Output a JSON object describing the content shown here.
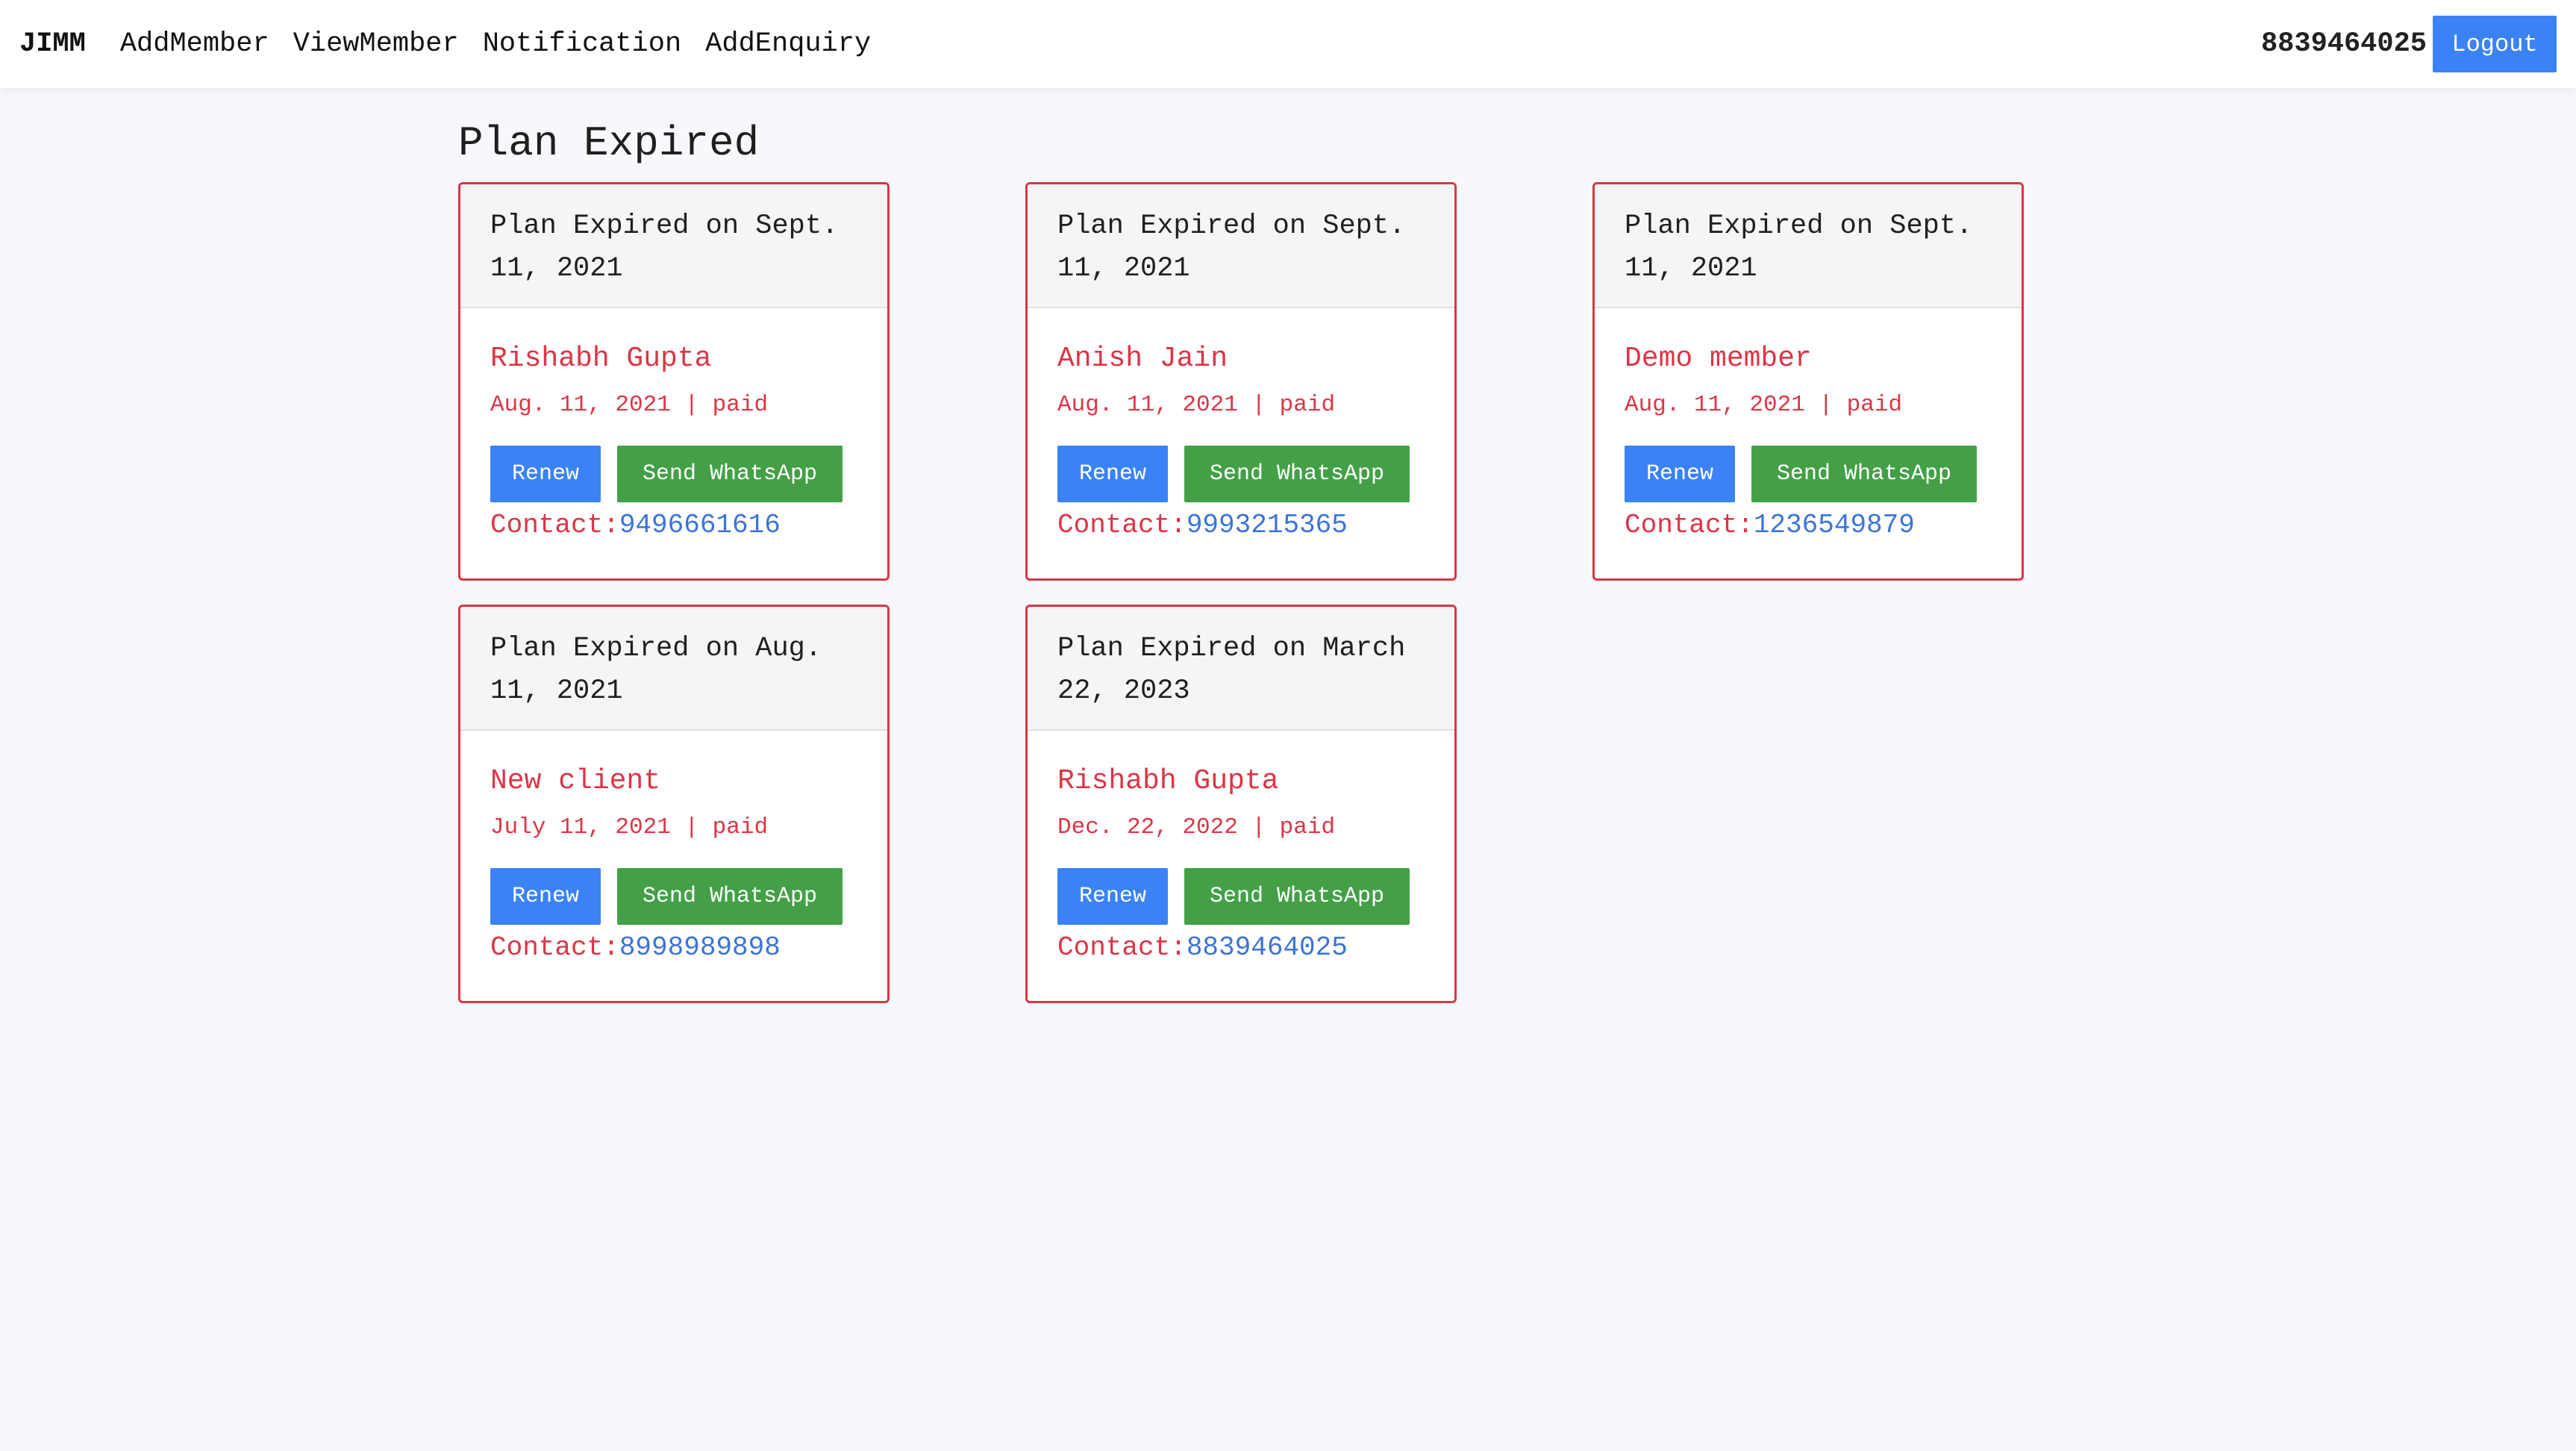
{
  "navbar": {
    "brand": "JIMM",
    "links": [
      "AddMember",
      "ViewMember",
      "Notification",
      "AddEnquiry"
    ],
    "phone": "8839464025",
    "logout_label": "Logout"
  },
  "page": {
    "title": "Plan Expired"
  },
  "cards": [
    {
      "header": "Plan Expired on Sept. 11, 2021",
      "name": "Rishabh Gupta",
      "meta": "Aug. 11, 2021 | paid",
      "renew_label": "Renew",
      "whatsapp_label": "Send WhatsApp",
      "contact_label": "Contact:",
      "contact_number": "9496661616"
    },
    {
      "header": "Plan Expired on Sept. 11, 2021",
      "name": "Anish Jain",
      "meta": "Aug. 11, 2021 | paid",
      "renew_label": "Renew",
      "whatsapp_label": "Send WhatsApp",
      "contact_label": "Contact:",
      "contact_number": "9993215365"
    },
    {
      "header": "Plan Expired on Sept. 11, 2021",
      "name": "Demo member",
      "meta": "Aug. 11, 2021 | paid",
      "renew_label": "Renew",
      "whatsapp_label": "Send WhatsApp",
      "contact_label": "Contact:",
      "contact_number": "1236549879"
    },
    {
      "header": "Plan Expired on Aug. 11, 2021",
      "name": "New client",
      "meta": "July 11, 2021 | paid",
      "renew_label": "Renew",
      "whatsapp_label": "Send WhatsApp",
      "contact_label": "Contact:",
      "contact_number": "8998989898"
    },
    {
      "header": "Plan Expired on March 22, 2023",
      "name": "Rishabh Gupta",
      "meta": "Dec. 22, 2022 | paid",
      "renew_label": "Renew",
      "whatsapp_label": "Send WhatsApp",
      "contact_label": "Contact:",
      "contact_number": "8839464025"
    }
  ],
  "colors": {
    "card_border": "#dc3545",
    "primary_button": "#3b82f6",
    "whatsapp_button": "#43a047",
    "contact_link": "#3b74d6"
  }
}
